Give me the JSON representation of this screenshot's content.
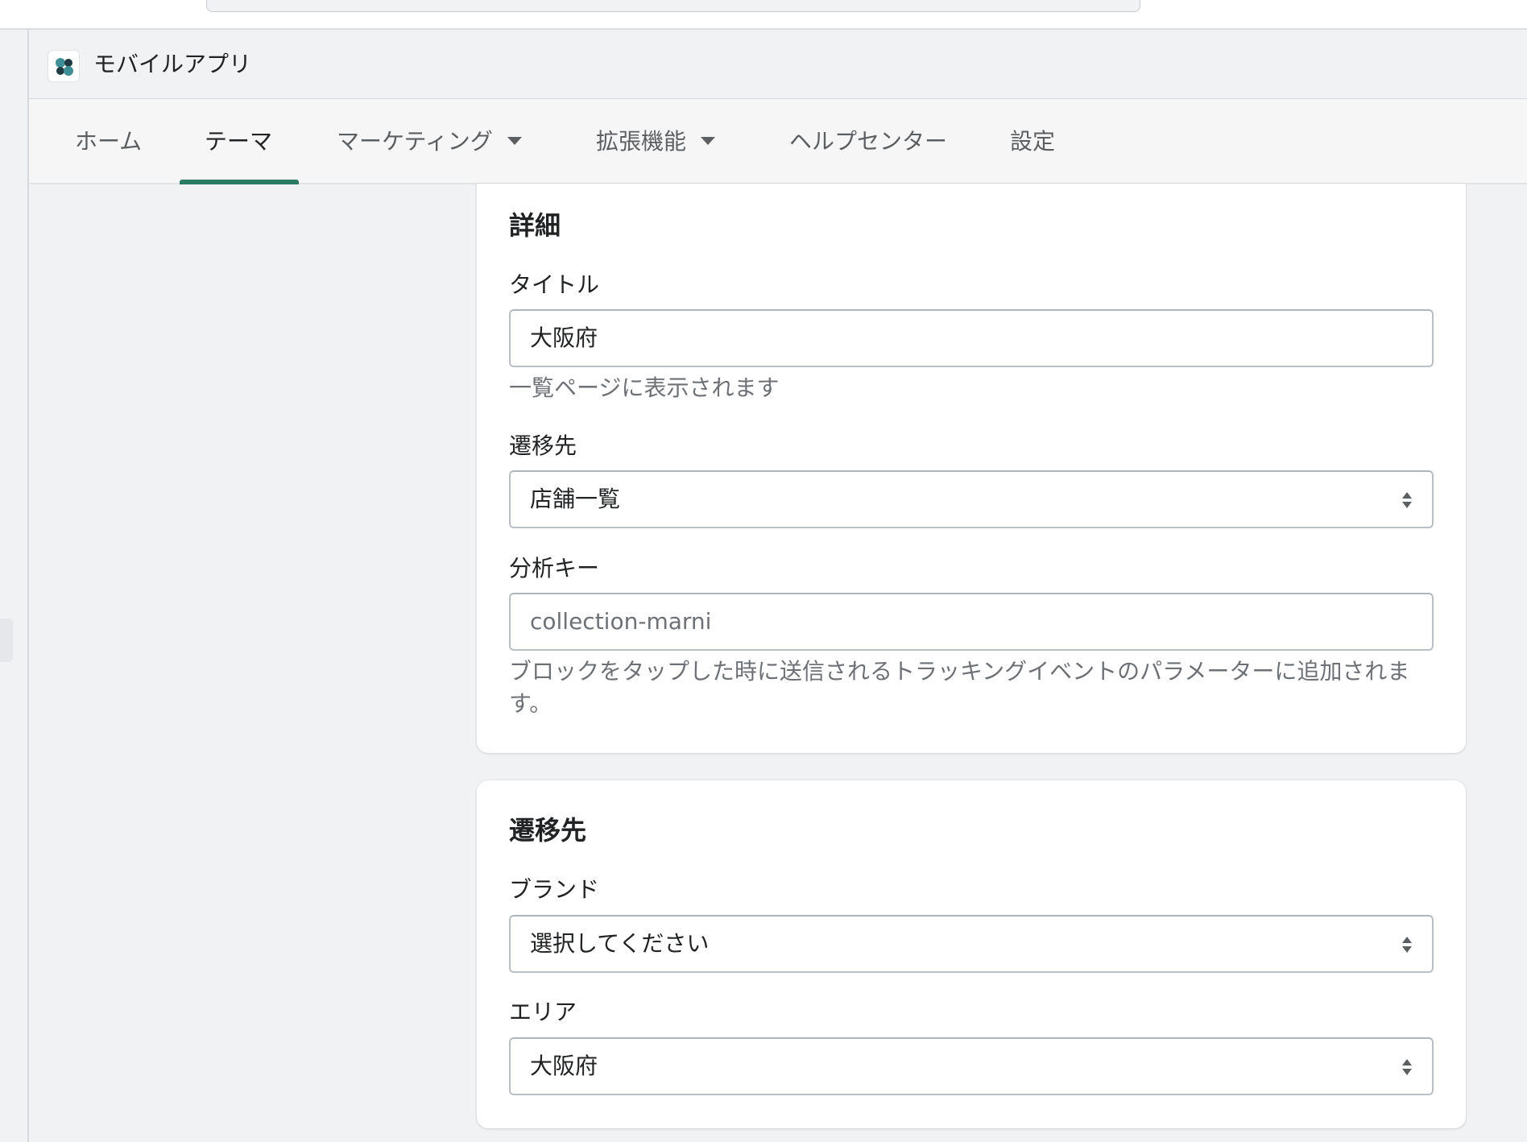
{
  "app": {
    "title": "モバイルアプリ"
  },
  "nav": {
    "items": [
      {
        "label": "ホーム"
      },
      {
        "label": "テーマ"
      },
      {
        "label": "マーケティング"
      },
      {
        "label": "拡張機能"
      },
      {
        "label": "ヘルプセンター"
      },
      {
        "label": "設定"
      }
    ],
    "active": "テーマ"
  },
  "details": {
    "heading": "詳細",
    "title_label": "タイトル",
    "title_value": "大阪府",
    "title_help": "一覧ページに表示されます",
    "destination_label": "遷移先",
    "destination_value": "店舗一覧",
    "analytics_label": "分析キー",
    "analytics_value": "collection-marni",
    "analytics_help": "ブロックをタップした時に送信されるトラッキングイベントのパラメーターに追加されます。"
  },
  "destination": {
    "heading": "遷移先",
    "brand_label": "ブランド",
    "brand_value": "選択してください",
    "area_label": "エリア",
    "area_value": "大阪府"
  },
  "colors": {
    "accent": "#2a7b63",
    "background": "#f1f2f4",
    "card": "#ffffff"
  },
  "icons": {
    "app": "app-logo-icon",
    "dropdown": "caret-down-icon",
    "select": "select-arrows-icon"
  }
}
